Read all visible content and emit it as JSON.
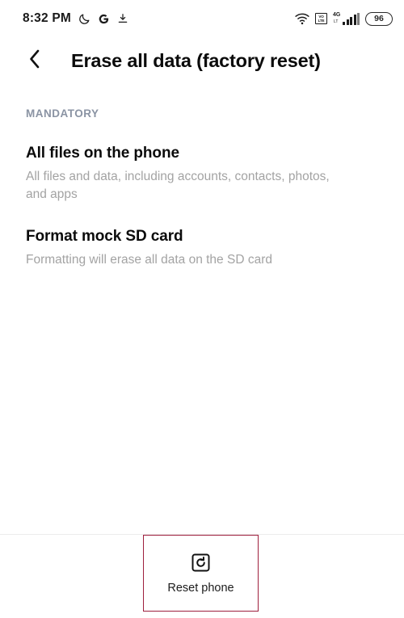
{
  "status_bar": {
    "time": "8:32 PM",
    "left_icons": [
      {
        "name": "do-not-disturb-icon",
        "glyph": "moon"
      },
      {
        "name": "google-icon",
        "glyph": "G"
      },
      {
        "name": "download-icon",
        "glyph": "download-arrow"
      }
    ],
    "right_icons": [
      {
        "name": "wifi-icon",
        "glyph": "wifi"
      },
      {
        "name": "volte-icon",
        "line1": "VO",
        "line2": "LTE"
      },
      {
        "name": "cellular-signal-icon",
        "network": "4G",
        "sub": "LT"
      }
    ],
    "battery": {
      "level": "96"
    }
  },
  "app_bar": {
    "back_icon": "chevron-left-icon",
    "title": "Erase all data (factory reset)"
  },
  "main": {
    "section_label": "MANDATORY",
    "items": [
      {
        "title": "All files on the phone",
        "subtitle": "All files and data, including accounts, contacts, photos, and apps"
      },
      {
        "title": "Format mock SD card",
        "subtitle": "Formatting will erase all data on the SD card"
      }
    ]
  },
  "bottom_action": {
    "icon": "reset-phone-icon",
    "label": "Reset phone",
    "highlight_color": "#9e1f3d"
  }
}
